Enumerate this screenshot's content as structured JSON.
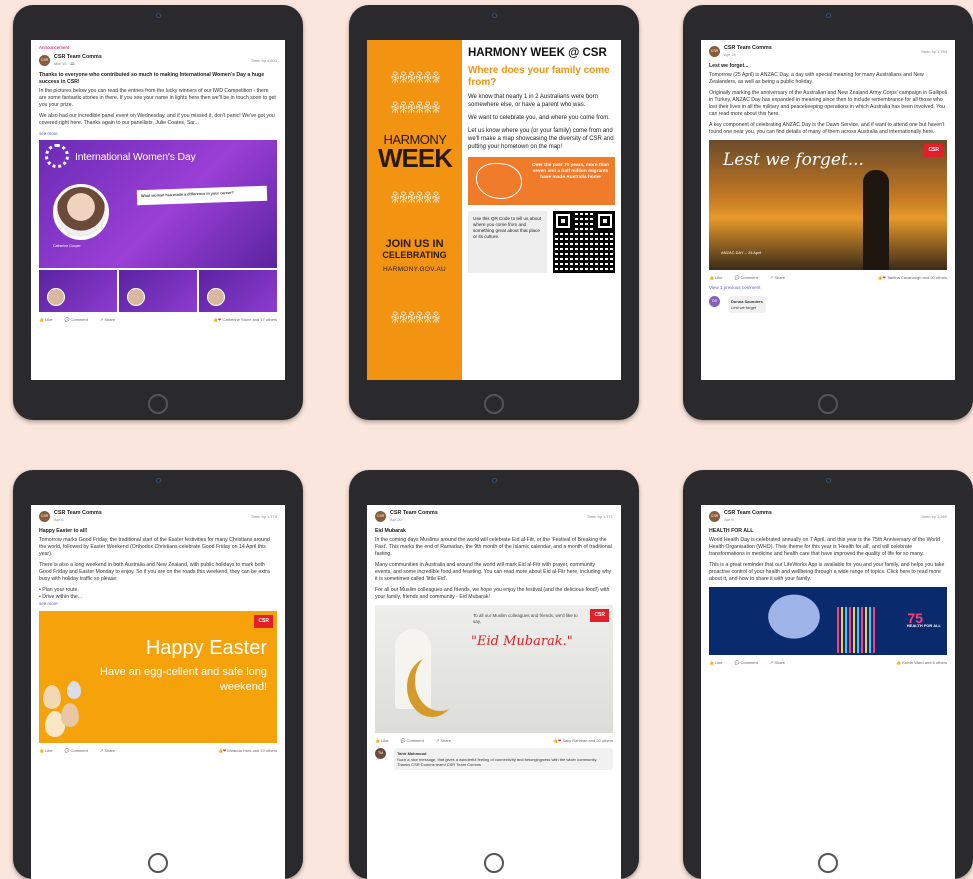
{
  "post_author": "CSR Team Comms",
  "actions": {
    "like": "Like",
    "comment": "Comment",
    "share": "Share"
  },
  "iwd": {
    "tag": "Announcement",
    "date": "Mar 15 · 🕮",
    "seen": "Seen by 1,603",
    "title": "Thanks to everyone who contributed so much to making International Women's Day a huge success in CSR!",
    "p1": "In the pictures below you can read the entries from the lucky winners of our IWD Competition - there are some fantastic stories in there. If you see your name in lights here then we'll be in touch soon to get you your prize.",
    "p2": "We also had our incredible panel event on Wednesday, and if you missed it, don't panic! We've got you covered right here. Thanks again to our panellists, Julie Coates, Sar...",
    "see_more": "see more",
    "banner": "International Women's Day",
    "photo_name": "Catherine Cooper",
    "quote_title": "What woman has made a difference in your career?",
    "reactions": "Catherine Stone and 17 others"
  },
  "harmony": {
    "heading": "HARMONY WEEK @ CSR",
    "subheading": "Where does your family come from?",
    "p1": "We know that nearly 1 in 2 Australians were born somewhere else, or have a parent who was.",
    "p2": "We want to celebrate you, and where you come from.",
    "p3": "Let us know where you (or your family) come from and we'll make a map showcasing the diversity of CSR and putting your hometown on the map!",
    "logo_top": "HARMONY",
    "logo_bottom": "WEEK",
    "join1": "JOIN US IN",
    "join2": "CELEBRATING",
    "url": "HARMONY.GOV.AU",
    "box_text": "Over the past 70 years, more than seven and a half million migrants have made Australia home",
    "qr_text": "Use this QR Code to tell us about where you come from and something great about that place or its culture."
  },
  "anzac": {
    "date": "Apr 24",
    "seen": "Seen by 1,784",
    "title": "Lest we forget...",
    "p1": "Tomorrow (25 April) is ANZAC Day, a day with special meaning for many Australians and New Zealanders, as well as being a public holiday.",
    "p2": "Originally marking the anniversary of the Australian and New Zealand Army Corps' campaign in Gallipoli in Turkey, ANZAC Day has expanded in meaning since then to include remembrance for all those who lost their lives in all the military and peacekeeping operations in which Australia has been involved. You can read more about this here.",
    "p3": "A key component of celebrating ANZAC Day is the Dawn Service, and if want to attend one but haven't found one near you, you can find details of many of them across Australia and internationally here.",
    "image_text": "Lest we forget...",
    "caption": "ANZAC DAY – 25 April",
    "reactions": "Tabitha Cavanaugh and 20 others",
    "view_prev": "View 1 previous comment",
    "commenter": "Donna Saunders",
    "comment": "Lest we forget"
  },
  "easter": {
    "date": "Apr 6",
    "seen": "Seen by 1,774",
    "title": "Happy Easter to all!",
    "p1": "Tomorrow marks Good Friday, the traditional start of the Easter festivities for many Christians around the world, followed by Easter Weekend (Orthodox Christians celebrate Good Friday on 14 April this year).",
    "p2": "There is also a long weekend in both Australia and New Zealand, with public holidays to mark both Good Friday and Easter Monday to enjoy. So if you are on the roads this weekend, they can be extra busy with holiday traffic so please:",
    "b1": "Plan your route.",
    "b2": "Drive within the...",
    "see_more": "see more",
    "img1": "Happy Easter",
    "img2": "Have an egg-cellent and safe long weekend!",
    "reactions": "Miranda Hunt and 19 others"
  },
  "eid": {
    "date": "Apr 20",
    "seen": "Seen by 1,771",
    "title": "Eid Mubarak",
    "p1": "In the coming days Muslims around the world will celebrate Eid al-Fitr, or the 'Festival of Breaking the Fast'. This marks the end of Ramadan, the 9th month of the Islamic calendar, and a month of traditional fasting.",
    "p2": "Many communities in Australia and around the world will mark Eid al-Fitr with prayer, community events, and some incredible food and feasting. You can read more about Eid al-Fitr here, including why it is sometimes called 'little Eid'.",
    "p3": "For all our Muslim colleagues and friends, we hope you enjoy the festival (and the delicious food!) with your family, friends and community - Eid Mubarak!",
    "img_small": "To all our Muslim colleagues and friends, we'd like to say,",
    "img_big": "\"Eid Mubarak.\"",
    "reactions": "Sally Rahman and 20 others",
    "commenter": "Tahir Mahmood",
    "comment": "Such a nice message, that gives a wonderful feeling of connectivity and belongingness with the wider community. Thanks CSR Comms team! CSR Team Comms"
  },
  "health": {
    "date": "Apr 5",
    "seen": "Seen by 1,260",
    "title": "HEALTH FOR ALL",
    "p1": "World Health Day is celebrated annually on 7 April, and this year is the 75th Anniversary of the World Health Organisation (WHO). Their theme for this year is 'Health for all', and will celebrate transformations in medicine and health care that have improved the quality of life for so many.",
    "p2": "This is a great reminder that our LifeWorks App is available for you and your family, and helps you take proactive control of your health and wellbeing through a wide range of topics. Click here to read more about it, and how to share it with your family.",
    "num": "75",
    "tag": "HEALTH FOR ALL",
    "reactions": "Kelvin Ward and 5 others"
  },
  "csr_badge": "CSR"
}
